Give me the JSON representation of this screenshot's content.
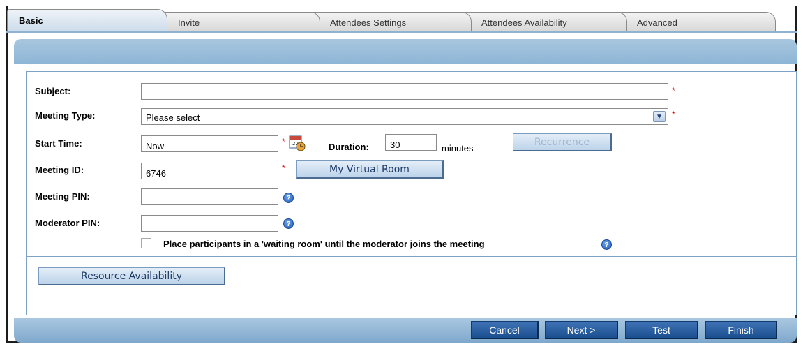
{
  "tabs": [
    {
      "label": "Basic",
      "active": true
    },
    {
      "label": "Invite"
    },
    {
      "label": "Attendees Settings"
    },
    {
      "label": "Attendees Availability"
    },
    {
      "label": "Advanced"
    }
  ],
  "form": {
    "subject_label": "Subject:",
    "subject_value": "",
    "meeting_type_label": "Meeting Type:",
    "meeting_type_value": "Please select",
    "start_time_label": "Start Time:",
    "start_time_value": "Now",
    "duration_label": "Duration:",
    "duration_value": "30",
    "duration_unit": "minutes",
    "recurrence_label": "Recurrence",
    "meeting_id_label": "Meeting ID:",
    "meeting_id_value": "6746",
    "virtual_room_label": "My Virtual Room",
    "meeting_pin_label": "Meeting PIN:",
    "meeting_pin_value": "",
    "moderator_pin_label": "Moderator PIN:",
    "moderator_pin_value": "",
    "waiting_room_label": "Place participants in a 'waiting room' until the moderator joins the meeting",
    "required_mark": "*",
    "help_glyph": "?",
    "resource_availability_label": "Resource Availability"
  },
  "footer": {
    "cancel_label": "Cancel",
    "next_label": "Next >",
    "test_label": "Test",
    "finish_label": "Finish"
  },
  "colors": {
    "accent": "#8db5d6",
    "footer_button": "#1a4f90",
    "required": "#dd0000"
  }
}
